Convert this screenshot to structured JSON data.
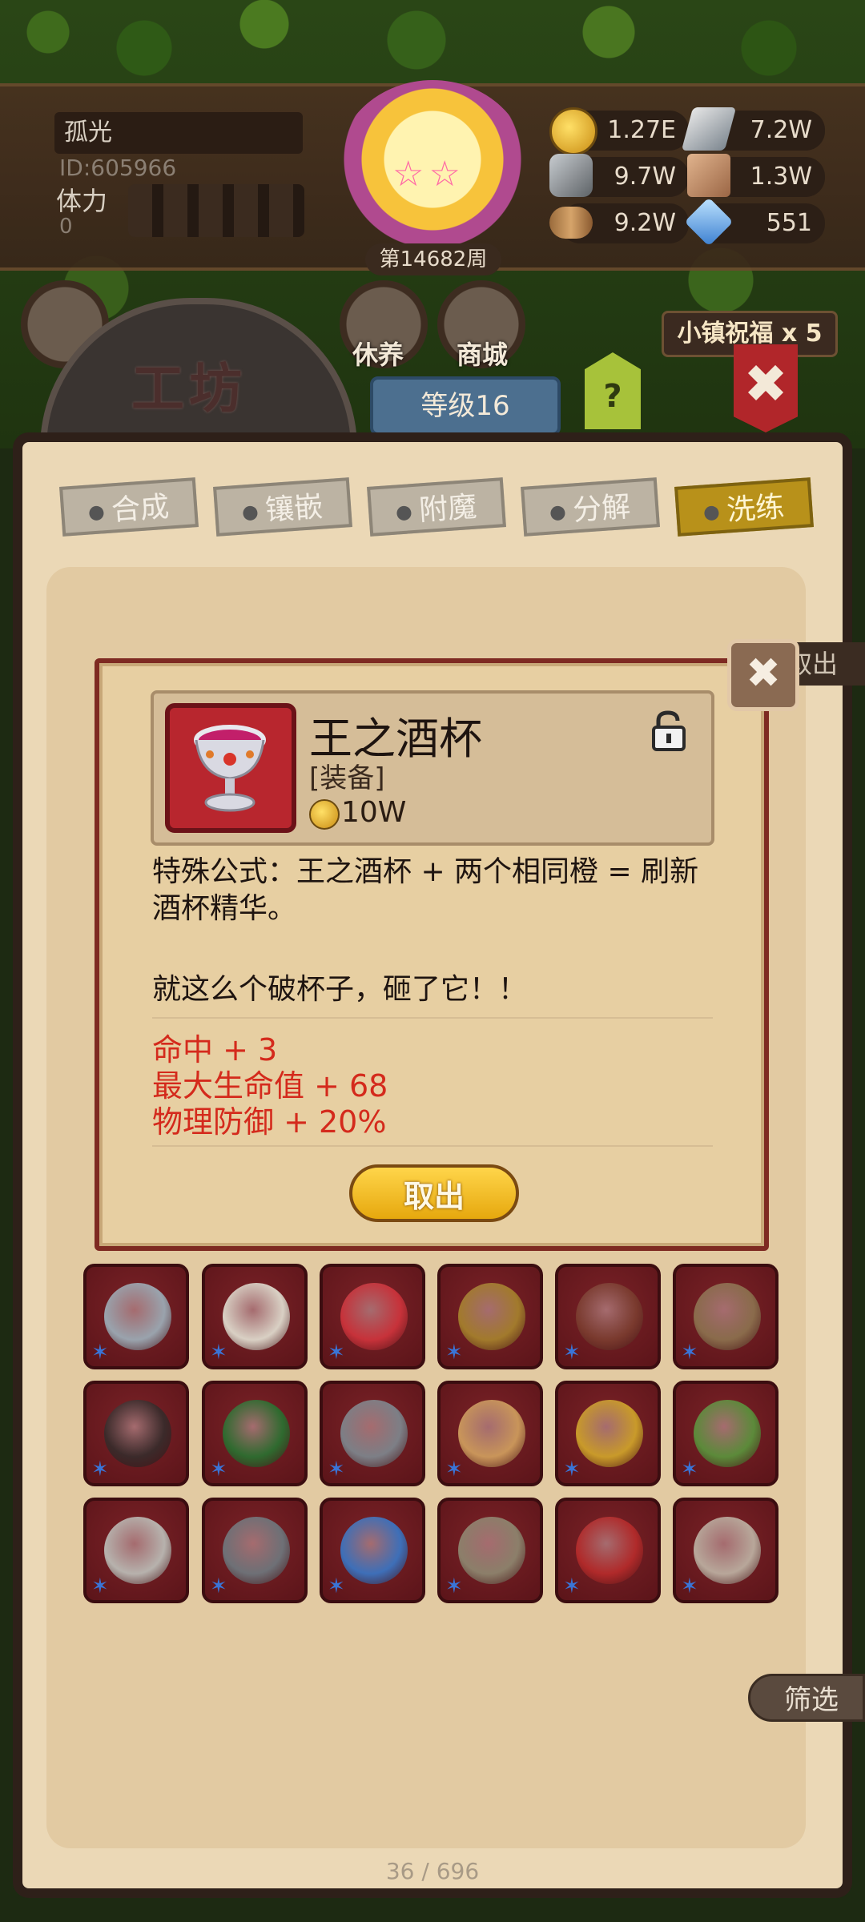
{
  "hud": {
    "player_name": "孤光",
    "player_id": "ID:605966",
    "stamina_label": "体力",
    "stamina_value": "0",
    "week": "第14682周",
    "resources": [
      {
        "icon": "gold-coin-icon",
        "value": "1.27E"
      },
      {
        "icon": "iron-ingot-icon",
        "value": "7.2W"
      },
      {
        "icon": "stone-ore-icon",
        "value": "9.7W"
      },
      {
        "icon": "leather-icon",
        "value": "1.3W"
      },
      {
        "icon": "wood-log-icon",
        "value": "9.2W"
      },
      {
        "icon": "blue-gem-icon",
        "value": "551"
      }
    ]
  },
  "nav": {
    "rest": "休养",
    "shop": "商城",
    "blessing": "小镇祝福 x 5",
    "workshop_title": "工坊",
    "level": "等级16",
    "help": "?",
    "close": "✖"
  },
  "tabs": [
    {
      "label": "合成",
      "active": false
    },
    {
      "label": "镶嵌",
      "active": false
    },
    {
      "label": "附魔",
      "active": false
    },
    {
      "label": "分解",
      "active": false
    },
    {
      "label": "洗练",
      "active": true
    }
  ],
  "side": {
    "takeout_label": "取出",
    "filter_label": "筛选"
  },
  "pager": "36 / 696",
  "inventory": [
    {
      "icon": "crown-icon",
      "color": "#9aa3ad"
    },
    {
      "icon": "scepter-icon",
      "color": "#d9d0c4"
    },
    {
      "icon": "amulet-icon",
      "color": "#c7323a"
    },
    {
      "icon": "gauntlet-icon",
      "color": "#a27a2c"
    },
    {
      "icon": "belt-icon",
      "color": "#7a3a2e"
    },
    {
      "icon": "ring-icon",
      "color": "#8a6b4b"
    },
    {
      "icon": "whip-icon",
      "color": "#3b2a2a"
    },
    {
      "icon": "green-armor-icon",
      "color": "#2f6a2f"
    },
    {
      "icon": "spear-icon",
      "color": "#7d7f86"
    },
    {
      "icon": "potion-icon",
      "color": "#c9955a"
    },
    {
      "icon": "gold-ring-icon",
      "color": "#c99a2a"
    },
    {
      "icon": "green-claw-icon",
      "color": "#5c8a3a"
    },
    {
      "icon": "skull-blade-icon",
      "color": "#b7b2ad"
    },
    {
      "icon": "iron-glove-icon",
      "color": "#6e7076"
    },
    {
      "icon": "crystal-orb-icon",
      "color": "#3e6fb8"
    },
    {
      "icon": "spellbook-icon",
      "color": "#8c7f6a"
    },
    {
      "icon": "red-book-icon",
      "color": "#b02a2a"
    },
    {
      "icon": "cloak-icon",
      "color": "#b8a79a"
    }
  ],
  "modal": {
    "item_name": "王之酒杯",
    "item_type": "[装备]",
    "price": "10W",
    "description": "特殊公式：王之酒杯 + 两个相同橙 = 刷新酒杯精华。",
    "quote": "就这么个破杯子，砸了它！！",
    "stats": [
      "命中 + 3",
      "最大生命值 + 68",
      "物理防御 + 20%"
    ],
    "take_out_button": "取出",
    "close_button": "✖"
  }
}
